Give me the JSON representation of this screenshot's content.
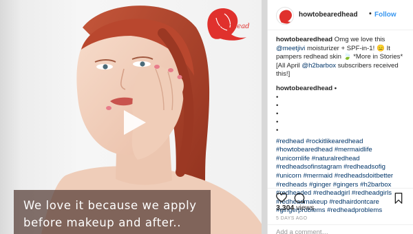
{
  "media": {
    "brand_logo_text": "Redhead",
    "caption_lines": [
      "We love it because we apply",
      "before makeup and after.."
    ]
  },
  "post": {
    "username": "howtobearedhead",
    "follow_label": "Follow",
    "header_separator": "•",
    "caption_text": "Omg we love this",
    "caption_mention_1": "@meetjivi",
    "caption_text_2": "moisturizer + SPF-in-1! 😑 It pampers redhead skin 🍃 *More in Stories* [All April",
    "caption_mention_2": "@h2barbox",
    "caption_text_3": "subscribers received this!]",
    "comment_username": "howtobearedhead •",
    "bullets": [
      "•",
      "•",
      "•",
      "•",
      "•"
    ],
    "hashtag_lines": [
      "#redhead #rockitlikearedhead",
      "#howtobearedhead #mermaidlife",
      "#unicornlife #naturalredhead",
      "#redheadsofinstagram #redheadsofig",
      "#unicorn #mermaid #redheadsdoitbetter",
      "#redheads #ginger #gingers #h2barbox",
      "#redheaded #redheadgirl #redheadgirls",
      "#redheadmakeup #redhairdontcare",
      "#gingerproblems #redheadproblems"
    ],
    "views_count": "3,304",
    "views_label": "views",
    "timestamp": "5 DAYS AGO",
    "add_comment_placeholder": "Add a comment…"
  },
  "icons": {
    "play": "play-icon",
    "like": "heart-icon",
    "comment": "comment-icon",
    "save": "bookmark-icon"
  },
  "colors": {
    "link": "#3897f0",
    "hashtag": "#003569",
    "brand_red": "#e0312d",
    "caption_bg": "#553c34"
  }
}
